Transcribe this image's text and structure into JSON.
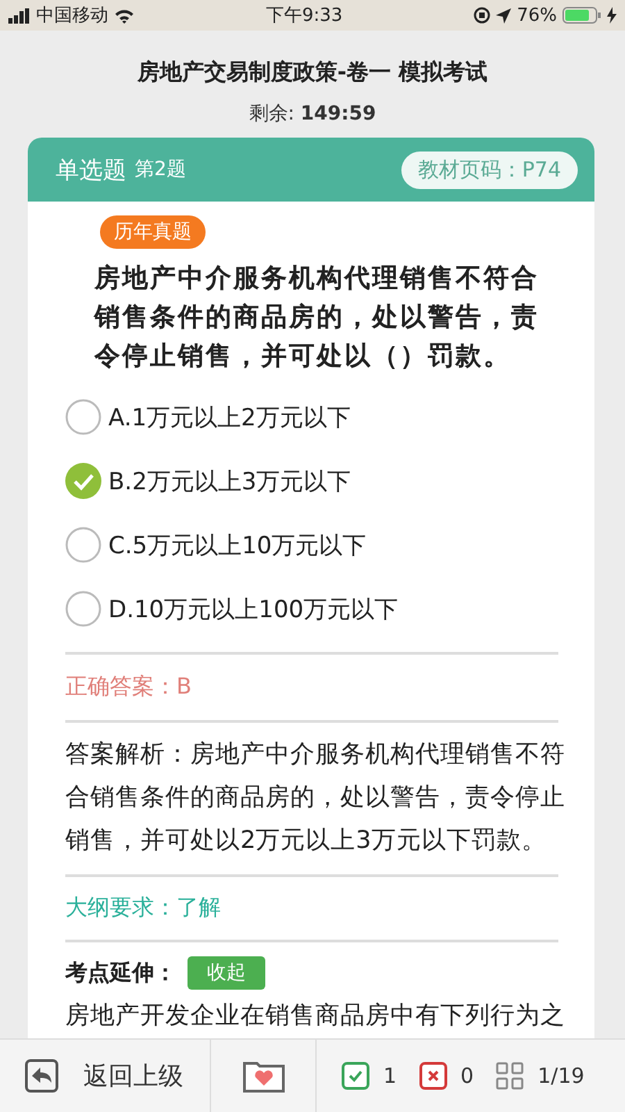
{
  "status_bar": {
    "carrier": "中国移动",
    "time": "下午9:33",
    "battery": "76%"
  },
  "title": "房地产交易制度政策-卷一 模拟考试",
  "timer": {
    "label": "剩余:",
    "value": "149:59"
  },
  "question": {
    "type": "单选题",
    "number": "第2题",
    "page_ref": "教材页码：P74",
    "tag": "历年真题",
    "text": "房地产中介服务机构代理销售不符合销售条件的商品房的，处以警告，责令停止销售，并可处以（）罚款。",
    "options": [
      {
        "label": "A.1万元以上2万元以下",
        "selected": false
      },
      {
        "label": "B.2万元以上3万元以下",
        "selected": true
      },
      {
        "label": "C.5万元以上10万元以下",
        "selected": false
      },
      {
        "label": "D.10万元以上100万元以下",
        "selected": false
      }
    ],
    "answer": "正确答案：B",
    "analysis": "答案解析：房地产中介服务机构代理销售不符合销售条件的商品房的，处以警告，责令停止销售，并可处以2万元以上3万元以下罚款。",
    "syllabus": "大纲要求：了解",
    "extension": {
      "label": "考点延伸：",
      "button": "收起",
      "text": "房地产开发企业在销售商品房中有下列行为之"
    }
  },
  "bottom_bar": {
    "back": "返回上级",
    "correct_count": "1",
    "wrong_count": "0",
    "progress": "1/19"
  }
}
